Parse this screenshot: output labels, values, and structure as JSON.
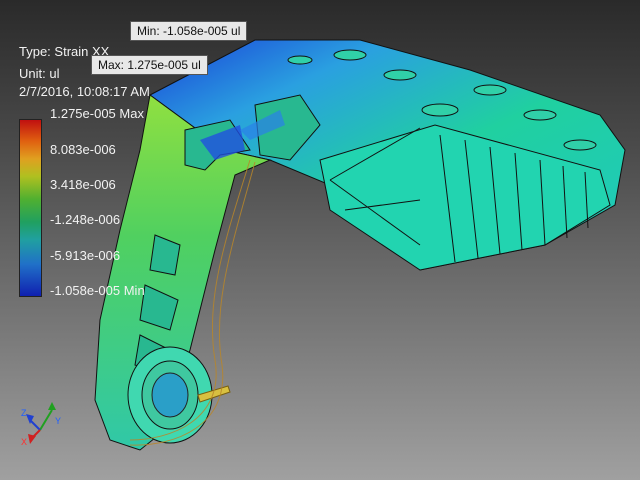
{
  "legend": {
    "type_label": "Type: Strain XX",
    "unit_label": "Unit: ul",
    "timestamp": "2/7/2016, 10:08:17 AM"
  },
  "color_scale": {
    "labels": [
      "1.275e-005 Max",
      "8.083e-006",
      "3.418e-006",
      "-1.248e-006",
      "-5.913e-006",
      "-1.058e-005 Min"
    ],
    "colors": [
      "#c01010",
      "#e06010",
      "#b0c020",
      "#20a060",
      "#2070c8",
      "#1020b0"
    ]
  },
  "probes": {
    "min": "Min: -1.058e-005 ul",
    "max": "Max: 1.275e-005 ul"
  },
  "triad": {
    "x": "X",
    "y": "Y",
    "z": "Z",
    "x_color": "#d02020",
    "y_color": "#20a020",
    "z_color": "#2040d0"
  }
}
